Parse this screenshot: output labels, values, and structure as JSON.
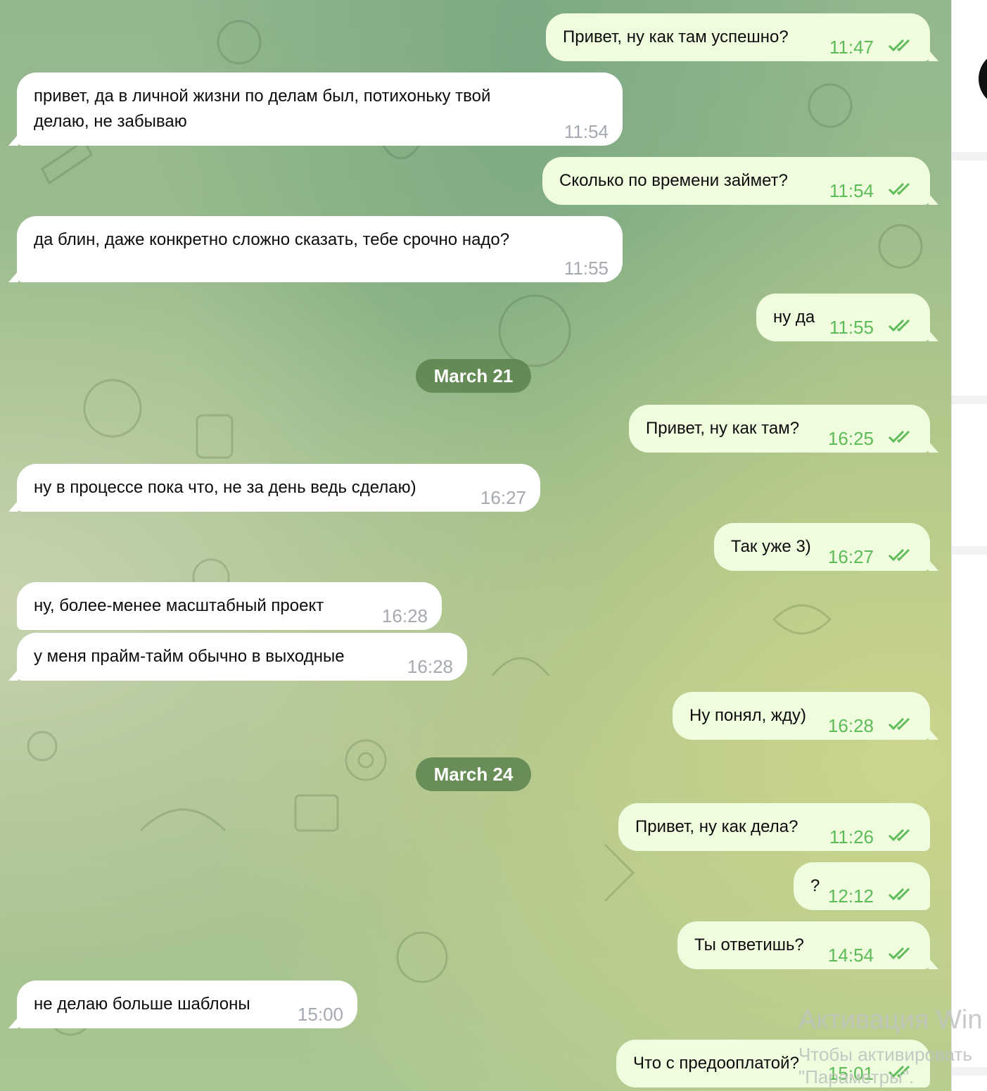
{
  "messages": [
    {
      "dir": "out",
      "text": "Привет, ну как там успешно?",
      "time": "11:47"
    },
    {
      "dir": "in",
      "text_line1": "привет, да в личной жизни по делам был, потихоньку твой",
      "text_line2": "делаю, не забываю",
      "time": "11:54"
    },
    {
      "dir": "out",
      "text": "Сколько по времени займет?",
      "time": "11:54"
    },
    {
      "dir": "in",
      "text": "да блин, даже конкретно сложно сказать, тебе срочно надо?",
      "time": "11:55"
    },
    {
      "dir": "out",
      "text": "ну да",
      "time": "11:55"
    },
    {
      "dir": "out",
      "text": "Привет, ну как там?",
      "time": "16:25"
    },
    {
      "dir": "in",
      "text": "ну в процессе пока что, не за день ведь сделаю)",
      "time": "16:27"
    },
    {
      "dir": "out",
      "text": "Так уже 3)",
      "time": "16:27"
    },
    {
      "dir": "in",
      "text": "ну, более-менее масштабный проект",
      "time": "16:28"
    },
    {
      "dir": "in",
      "text": "у меня прайм-тайм обычно в выходные",
      "time": "16:28"
    },
    {
      "dir": "out",
      "text": "Ну понял, жду)",
      "time": "16:28"
    },
    {
      "dir": "out",
      "text": "Привет, ну как дела?",
      "time": "11:26"
    },
    {
      "dir": "out",
      "text": "?",
      "time": "12:12"
    },
    {
      "dir": "out",
      "text": "Ты ответишь?",
      "time": "14:54"
    },
    {
      "dir": "in",
      "text": "не делаю больше шаблоны",
      "time": "15:00"
    },
    {
      "dir": "out",
      "text": "Что с предооплатой?",
      "time": "15:01"
    }
  ],
  "dates": [
    "March 21",
    "March 24"
  ],
  "watermark": {
    "line1": "Активация Win",
    "line2": "Чтобы активировать",
    "line3": "\"Параметры\"."
  },
  "icons": {
    "read_receipt": "double-check-icon"
  },
  "colors": {
    "outgoing_bubble": "#effdde",
    "incoming_bubble": "#ffffff",
    "time_outgoing": "#5dbb5a",
    "time_incoming": "#a5aab0",
    "date_badge": "#5c824e"
  }
}
